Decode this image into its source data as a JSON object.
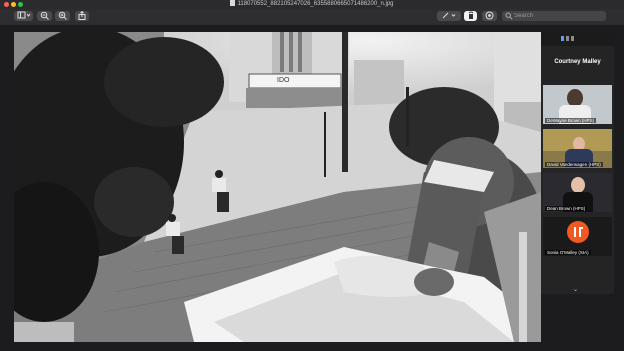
{
  "window": {
    "title": "118070552_882105247026_6355880665071486200_n.jpg",
    "traffic_colors": [
      "#ff5f57",
      "#febc2e",
      "#28c840"
    ]
  },
  "toolbar": {
    "sidebar_icon": "sidebar-icon",
    "zoom_out_icon": "zoom-out-icon",
    "zoom_in_icon": "zoom-in-icon",
    "share_icon": "share-icon",
    "markup_icon": "markup-pen-icon",
    "rotate_icon": "rotate-icon",
    "annotate_icon": "annotate-icon",
    "search_placeholder": "Search",
    "search_icon": "search-icon"
  },
  "photo": {
    "storefront_sign": "IDO"
  },
  "zoom": {
    "host_name": "Courtney Malley",
    "participants": [
      {
        "name": "DeWayne Brown (HPS)"
      },
      {
        "name": "David Vanderwagen (HPS)"
      },
      {
        "name": "Dean Brown (HPS)"
      },
      {
        "name": "Sonia O'Malley (SIA)"
      }
    ],
    "chevron": "⌄"
  }
}
